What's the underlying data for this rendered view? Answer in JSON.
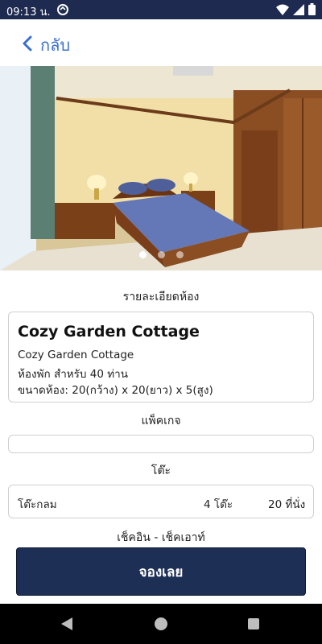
{
  "status": {
    "time": "09:13 น."
  },
  "header": {
    "back_label": "กลับ"
  },
  "gallery": {
    "image_count": 3,
    "active_index": 0
  },
  "details": {
    "section_title": "รายละเอียดห้อง",
    "room_name": "Cozy Garden Cottage",
    "line1": "Cozy Garden Cottage",
    "line2": "ห้องพัก  สำหรับ 40 ท่าน",
    "line3": "ขนาดห้อง: 20(กว้าง) x 20(ยาว) x 5(สูง)"
  },
  "package": {
    "section_title": "แพ็คเกจ",
    "value": ""
  },
  "tables": {
    "section_title": "โต๊ะ",
    "row": {
      "type": "โต๊ะกลม",
      "count": "4 โต๊ะ",
      "seats": "20 ที่นั่ง"
    }
  },
  "checkin": {
    "section_title": "เช็คอิน - เช็คเอาท์"
  },
  "book_button": {
    "label": "จองเลย",
    "color": "#1e2f56"
  }
}
